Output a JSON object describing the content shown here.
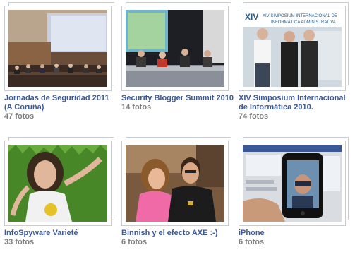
{
  "albums": [
    {
      "title": "Jornadas de Seguridad 2011 (A Coruña)",
      "count": "47 fotos",
      "photo": "conference-room-photo"
    },
    {
      "title": "Security Blogger Summit 2010",
      "count": "14 fotos",
      "photo": "panel-discussion-photo"
    },
    {
      "title": "XIV Simposium Internacional de Informática 2010.",
      "count": "74 fotos",
      "photo": "group-portrait-photo"
    },
    {
      "title": "InfoSpyware Varieté",
      "count": "33 fotos",
      "photo": "woman-on-grass-photo"
    },
    {
      "title": "Binnish y el efecto AXE :-)",
      "count": "6 fotos",
      "photo": "couple-photo"
    },
    {
      "title": "iPhone",
      "count": "6 fotos",
      "photo": "iphone-photo"
    }
  ],
  "photo_texts": {
    "banner_line1": "XIV SIMPOSIUM INTERNACIONAL DE",
    "banner_line2": "INFORMÁTICA ADMINISTRATIVA",
    "banner_xiv": "XIV"
  }
}
